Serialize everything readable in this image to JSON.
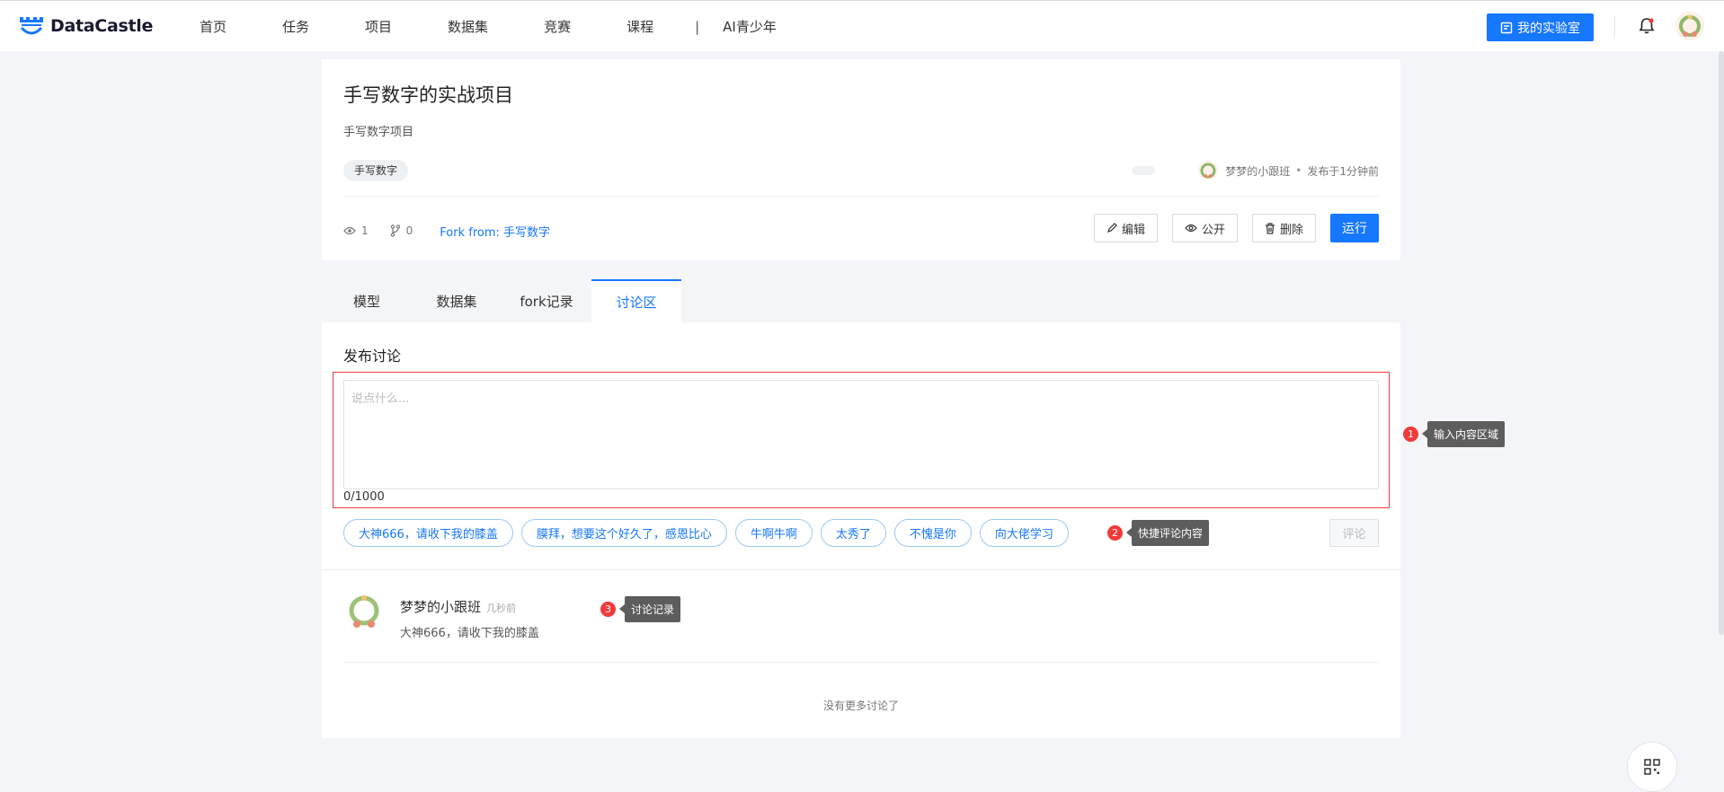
{
  "app": {
    "brand": "DataCastle"
  },
  "nav": {
    "items": [
      "首页",
      "任务",
      "项目",
      "数据集",
      "竞赛",
      "课程"
    ],
    "separator": "|",
    "extra": "AI青少年",
    "lab_button": "我的实验室"
  },
  "project": {
    "title": "手写数字的实战项目",
    "description": "手写数字项目",
    "tag": "手写数字",
    "author": "梦梦的小跟班",
    "dot": "•",
    "published": "发布于1分钟前",
    "views": "1",
    "forks": "0",
    "fork_from_label": "Fork from:",
    "fork_from_name": "手写数字",
    "actions": {
      "edit": "编辑",
      "public": "公开",
      "delete": "删除",
      "run": "运行"
    }
  },
  "tabs": [
    {
      "label": "模型",
      "active": false
    },
    {
      "label": "数据集",
      "active": false
    },
    {
      "label": "fork记录",
      "active": false
    },
    {
      "label": "讨论区",
      "active": true
    }
  ],
  "discussion": {
    "title": "发布讨论",
    "placeholder": "说点什么...",
    "counter": "0/1000",
    "quick_replies": [
      "大神666，请收下我的膝盖",
      "膜拜，想要这个好久了，感恩比心",
      "牛啊牛啊",
      "太秀了",
      "不愧是你",
      "向大佬学习"
    ],
    "submit": "评论",
    "comments": [
      {
        "author": "梦梦的小跟班",
        "time": "几秒前",
        "text": "大神666，请收下我的膝盖"
      }
    ],
    "no_more": "没有更多讨论了"
  },
  "annotations": [
    {
      "num": "1",
      "text": "输入内容区域"
    },
    {
      "num": "2",
      "text": "快捷评论内容"
    },
    {
      "num": "3",
      "text": "讨论记录"
    }
  ],
  "colors": {
    "accent": "#1677ff",
    "annotation_red": "#f23a3a",
    "tooltip_bg": "#5d5d5d",
    "page_bg": "#f3f5f8"
  }
}
